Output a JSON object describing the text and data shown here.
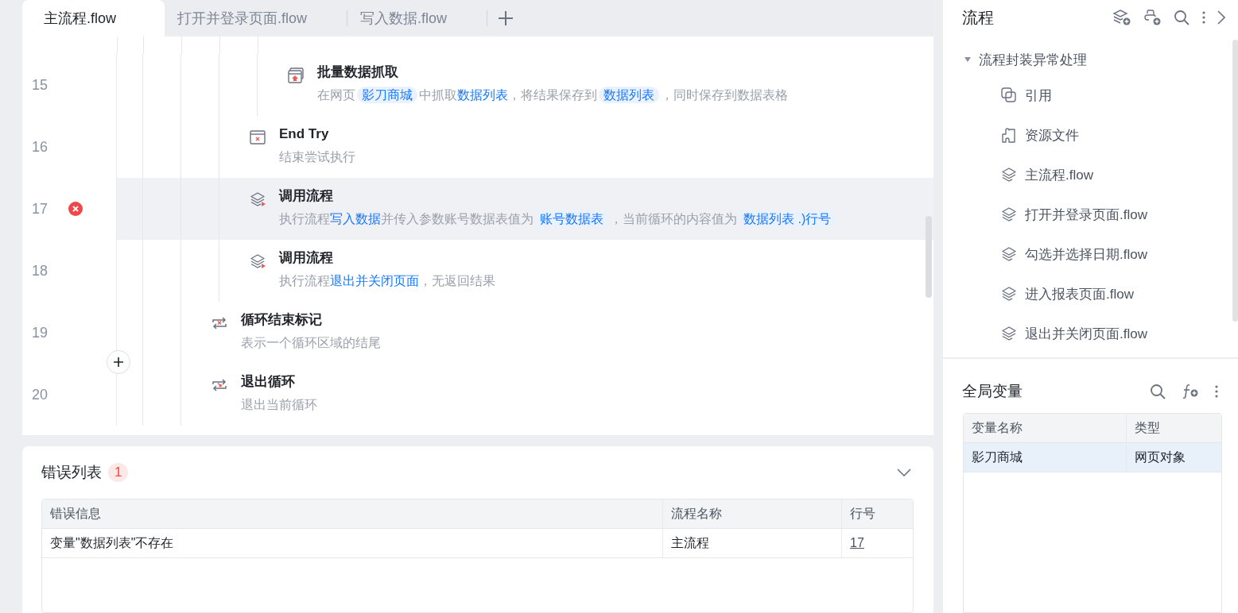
{
  "tabs": [
    {
      "label": "主流程.flow",
      "selected": true
    },
    {
      "label": "打开并登录页面.flow",
      "selected": false
    },
    {
      "label": "写入数据.flow",
      "selected": false
    }
  ],
  "steps": [
    {
      "children": [
        {
          "children": [
            {
              "line": "15",
              "kind": "scrape",
              "title": "批量数据抓取",
              "selected": false,
              "error": false,
              "desc": [
                {
                  "kind": "text",
                  "text": "在网页"
                },
                {
                  "kind": "chip",
                  "text": "影刀商城"
                },
                {
                  "kind": "text",
                  "text": "中抓取"
                },
                {
                  "kind": "link",
                  "text": "数据列表"
                },
                {
                  "kind": "text",
                  "text": "，将结果保存到"
                },
                {
                  "kind": "chip",
                  "text": "数据列表"
                },
                {
                  "kind": "text",
                  "text": "，同时保存到数据表格"
                }
              ]
            }
          ]
        },
        {
          "line": "16",
          "kind": "end-try",
          "title": "End Try",
          "selected": false,
          "error": false,
          "desc": [
            {
              "kind": "text",
              "text": "结束尝试执行"
            }
          ]
        },
        {
          "line": "17",
          "kind": "call-flow",
          "title": "调用流程",
          "selected": true,
          "error": true,
          "desc": [
            {
              "kind": "text",
              "text": "执行流程"
            },
            {
              "kind": "link",
              "text": "写入数据"
            },
            {
              "kind": "text",
              "text": "并传入参数账号数据表值为"
            },
            {
              "kind": "chip",
              "text": "账号数据表"
            },
            {
              "kind": "text",
              "text": "，当前循环的内容值为"
            },
            {
              "kind": "chip",
              "text": "数据列表 .)行号"
            }
          ]
        },
        {
          "line": "18",
          "kind": "call-flow",
          "title": "调用流程",
          "selected": false,
          "error": false,
          "desc": [
            {
              "kind": "text",
              "text": "执行流程"
            },
            {
              "kind": "link",
              "text": "退出并关闭页面"
            },
            {
              "kind": "text",
              "text": "，无返回结果"
            }
          ]
        }
      ]
    },
    {
      "line": "19",
      "kind": "loop-end",
      "title": "循环结束标记",
      "selected": false,
      "error": false,
      "desc": [
        {
          "kind": "text",
          "text": "表示一个循环区域的结尾"
        }
      ]
    },
    {
      "line": "20",
      "kind": "break",
      "title": "退出循环",
      "selected": false,
      "error": false,
      "desc": [
        {
          "kind": "text",
          "text": "退出当前循环"
        }
      ]
    }
  ],
  "error_list": {
    "title": "错误列表",
    "count": "1",
    "columns": [
      "错误信息",
      "流程名称",
      "行号"
    ],
    "rows": [
      {
        "message": "变量\"数据列表\"不存在",
        "flow": "主流程",
        "line": "17"
      }
    ]
  },
  "flows_panel": {
    "title": "流程",
    "tree": [
      {
        "label": "流程封装异常处理",
        "expanded": true,
        "children": [
          {
            "label": "引用",
            "kind": "reference"
          },
          {
            "label": "资源文件",
            "kind": "resource"
          },
          {
            "label": "主流程.flow",
            "kind": "flow"
          },
          {
            "label": "打开并登录页面.flow",
            "kind": "flow"
          },
          {
            "label": "勾选并选择日期.flow",
            "kind": "flow"
          },
          {
            "label": "进入报表页面.flow",
            "kind": "flow"
          },
          {
            "label": "退出并关闭页面.flow",
            "kind": "flow"
          }
        ]
      }
    ]
  },
  "global_variables": {
    "title": "全局变量",
    "columns": [
      "变量名称",
      "类型"
    ],
    "rows": [
      {
        "name": "影刀商城",
        "type": "网页对象",
        "selected": true
      }
    ]
  }
}
